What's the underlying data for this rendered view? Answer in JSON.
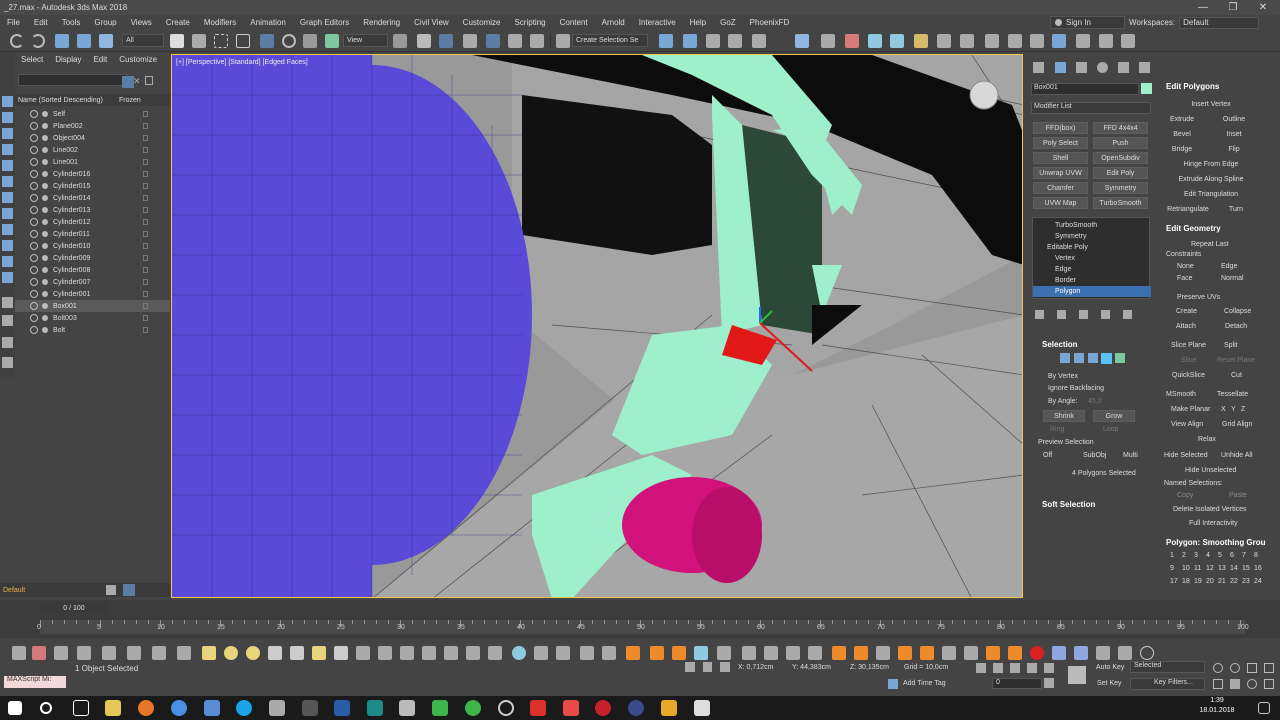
{
  "title": "_27.max - Autodesk 3ds Max 2018",
  "window_controls": [
    "—",
    "❐",
    "✕"
  ],
  "menu": [
    "File",
    "Edit",
    "Tools",
    "Group",
    "Views",
    "Create",
    "Modifiers",
    "Animation",
    "Graph Editors",
    "Rendering",
    "Civil View",
    "Customize",
    "Scripting",
    "Content",
    "Arnold",
    "Interactive",
    "Help",
    "GoZ",
    "PhoenixFD"
  ],
  "signin": "Sign In",
  "workspace_label": "Workspaces:",
  "workspace_value": "Default",
  "toolbar": {
    "filter": "All",
    "refcoord": "View",
    "selset": "Create Selection Se"
  },
  "scene_explorer": {
    "tabs": [
      "Select",
      "Display",
      "Edit",
      "Customize"
    ],
    "header_name": "Name (Sorted Descending)",
    "header_frozen": "Frozen",
    "rows": [
      "Self",
      "Plane002",
      "Object004",
      "Line002",
      "Line001",
      "Cylinder016",
      "Cylinder015",
      "Cylinder014",
      "Cylinder013",
      "Cylinder012",
      "Cylinder011",
      "Cylinder010",
      "Cylinder009",
      "Cylinder008",
      "Cylinder007",
      "Cylinder001",
      "Box001",
      "Bolt003",
      "Bolt"
    ],
    "selected_row": "Box001",
    "layer": "Default"
  },
  "viewport_label": "[+] [Perspective] [Standard] [Edged Faces]",
  "command_panel": {
    "object_name": "Box001",
    "modifier_list": "Modifier List",
    "buttons": [
      "FFD(box)",
      "FFD 4x4x4",
      "Poly Select",
      "Push",
      "Shell",
      "OpenSubdiv",
      "Unwrap UVW",
      "Edit Poly",
      "Chamfer",
      "Symmetry",
      "UVW Map",
      "TurboSmooth"
    ],
    "stack": [
      "TurboSmooth",
      "Symmetry",
      "Editable Poly",
      "Vertex",
      "Edge",
      "Border",
      "Polygon"
    ],
    "selection_title": "Selection",
    "by_vertex": "By Vertex",
    "ignore_backfacing": "Ignore Backfacing",
    "by_angle": "By Angle:",
    "angle_value": "45,0",
    "shrink": "Shrink",
    "grow": "Grow",
    "ring": "Ring",
    "loop": "Loop",
    "preview_selection": "Preview Selection",
    "preview_opts": [
      "Off",
      "SubObj",
      "Multi"
    ],
    "polys_selected": "4 Polygons Selected",
    "soft_selection": "Soft Selection"
  },
  "edit_polygons": {
    "title": "Edit Polygons",
    "insert_vertex": "Insert Vertex",
    "rows": [
      [
        "Extrude",
        "Outline"
      ],
      [
        "Bevel",
        "Inset"
      ],
      [
        "Bridge",
        "Flip"
      ]
    ],
    "hinge": "Hinge From Edge",
    "extrude_spline": "Extrude Along Spline",
    "edit_tri": "Edit Triangulation",
    "retri": "Retriangulate",
    "turn": "Turn"
  },
  "edit_geometry": {
    "title": "Edit Geometry",
    "repeat_last": "Repeat Last",
    "constraints": "Constraints",
    "c_opts": [
      [
        "None",
        "Edge"
      ],
      [
        "Face",
        "Normal"
      ]
    ],
    "preserve_uvs": "Preserve UVs",
    "create": "Create",
    "collapse": "Collapse",
    "attach": "Attach",
    "detach": "Detach",
    "slice_plane": "Slice Plane",
    "split": "Split",
    "slice": "Slice",
    "reset_plane": "Reset Plane",
    "quickslice": "QuickSlice",
    "cut": "Cut",
    "msmooth": "MSmooth",
    "tessellate": "Tessellate",
    "make_planar": "Make Planar",
    "xyz": [
      "X",
      "Y",
      "Z"
    ],
    "view_align": "View Align",
    "grid_align": "Grid Align",
    "relax": "Relax",
    "hide_selected": "Hide Selected",
    "unhide_all": "Unhide All",
    "hide_unselected": "Hide Unselected",
    "named_selections": "Named Selections:",
    "copy": "Copy",
    "paste": "Paste",
    "delete_isolated": "Delete Isolated Vertices",
    "full_interactivity": "Full Interactivity"
  },
  "smoothing": {
    "title": "Polygon: Smoothing Grou",
    "numbers": [
      "1",
      "2",
      "3",
      "4",
      "5",
      "6",
      "7",
      "8",
      "9",
      "10",
      "11",
      "12",
      "13",
      "14",
      "15",
      "16",
      "17",
      "18",
      "19",
      "20",
      "21",
      "22",
      "23",
      "24"
    ]
  },
  "timeline": {
    "frame": "0 / 100",
    "ticks": [
      "0",
      "5",
      "10",
      "15",
      "20",
      "25",
      "30",
      "35",
      "40",
      "45",
      "50",
      "55",
      "60",
      "65",
      "70",
      "75",
      "80",
      "85",
      "90",
      "95",
      "100"
    ]
  },
  "status": {
    "script": "MAXScript Mi:",
    "selected": "1 Object Selected",
    "x": "X: 0,712cm",
    "y": "Y: 44,383cm",
    "z": "Z: 30,135cm",
    "grid": "Grid = 10,0cm",
    "add_time_tag": "Add Time Tag",
    "frame_field": "0",
    "auto_key": "Auto Key",
    "set_key": "Set Key",
    "selected_dd": "Selected",
    "key_filters": "Key Filters..."
  },
  "clock": {
    "time": "1:39",
    "date": "18.01.2018"
  }
}
